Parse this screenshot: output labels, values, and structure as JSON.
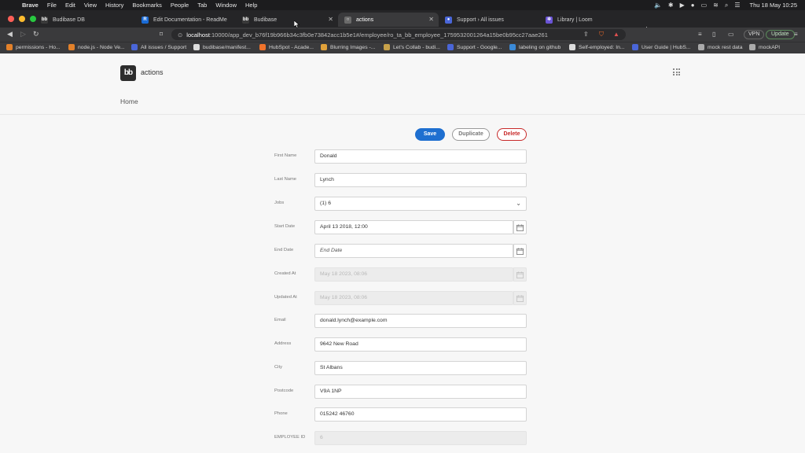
{
  "menubar": {
    "app": "Brave",
    "items": [
      "File",
      "Edit",
      "View",
      "History",
      "Bookmarks",
      "People",
      "Tab",
      "Window",
      "Help"
    ],
    "clock": "Thu 18 May  10:25"
  },
  "tabs": [
    {
      "label": "Budibase DB",
      "fav_color": "#3b3b3b",
      "fav_glyph": "bb"
    },
    {
      "label": "Edit Documentation - ReadMe",
      "fav_color": "#1a6bd6",
      "fav_glyph": "R"
    },
    {
      "label": "Budibase",
      "fav_color": "#3b3b3b",
      "fav_glyph": "bb"
    },
    {
      "label": "actions",
      "fav_color": "#6b6b6b",
      "fav_glyph": "○"
    },
    {
      "label": "Support › All issues",
      "fav_color": "#4a66d8",
      "fav_glyph": "●"
    },
    {
      "label": "Library | Loom",
      "fav_color": "#6a54d6",
      "fav_glyph": "✲"
    }
  ],
  "address": {
    "host": "localhost",
    "path": ":10000/app_dev_b76f19b966b34c3fb0e73842acc1b5e1#/employee/ro_ta_bb_employee_1759532001264a15be0b95cc27aae261",
    "vpn": "VPN",
    "update": "Update"
  },
  "bookmarks": [
    {
      "label": "permissions - Ho...",
      "color": "#e3812a"
    },
    {
      "label": "node.js - Node Ve...",
      "color": "#e3812a"
    },
    {
      "label": "All issues / Support",
      "color": "#4a66d8"
    },
    {
      "label": "budibase/manifest...",
      "color": "#dddddd"
    },
    {
      "label": "HubSpot - Acade...",
      "color": "#f0732b"
    },
    {
      "label": "Blurring Images -...",
      "color": "#e1a23a"
    },
    {
      "label": "Let's Collab - budi...",
      "color": "#c8a24a"
    },
    {
      "label": "Support - Google...",
      "color": "#4a66d8"
    },
    {
      "label": "labeling on github",
      "color": "#3a8ad8"
    },
    {
      "label": "Self-employed: In...",
      "color": "#dddddd"
    },
    {
      "label": "User Guide | HubS...",
      "color": "#4a66d8"
    },
    {
      "label": "mock rest data",
      "color": "#aaaaaa"
    },
    {
      "label": "mockAPI",
      "color": "#aaaaaa"
    }
  ],
  "app": {
    "logo": "bb",
    "title": "actions",
    "nav_home": "Home"
  },
  "actions": {
    "save": "Save",
    "duplicate": "Duplicate",
    "delete": "Delete"
  },
  "form": {
    "first_name": {
      "label": "First Name",
      "value": "Donald"
    },
    "last_name": {
      "label": "Last Name",
      "value": "Lynch"
    },
    "jobs": {
      "label": "Jobs",
      "value": "(1) 6"
    },
    "start_date": {
      "label": "Start Date",
      "value": "April 13 2018, 12:00"
    },
    "end_date": {
      "label": "End Date",
      "placeholder": "End Date"
    },
    "created_at": {
      "label": "Created At",
      "value": "May 18 2023, 08:06"
    },
    "updated_at": {
      "label": "Updated At",
      "value": "May 18 2023, 08:06"
    },
    "email": {
      "label": "Email",
      "value": "donald.lynch@example.com"
    },
    "address": {
      "label": "Address",
      "value": "9642 New Road"
    },
    "city": {
      "label": "City",
      "value": "St Albans"
    },
    "postcode": {
      "label": "Postcode",
      "value": "V9A 1NP"
    },
    "phone": {
      "label": "Phone",
      "value": "015242 46760"
    },
    "employee_id": {
      "label": "EMPLOYEE ID",
      "value": "6"
    }
  }
}
